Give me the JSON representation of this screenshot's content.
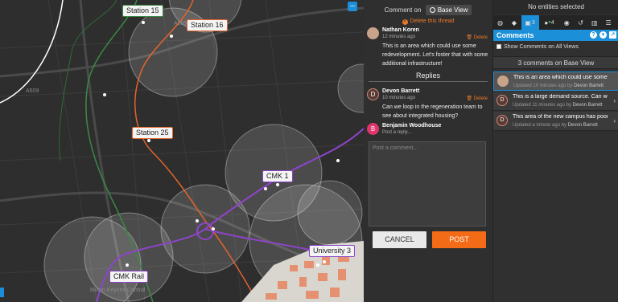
{
  "map": {
    "labels": {
      "station15": "Station 15",
      "station16": "Station 16",
      "station25": "Station 25",
      "cmk1": "CMK 1",
      "cmkrail": "CMK Rail",
      "university3": "University 3"
    },
    "roads": {
      "a509a": "A509",
      "a509b": "A509",
      "mkcentral": "Milton Keynes Central"
    }
  },
  "thread": {
    "comment_on": "Comment on",
    "view": "Base View",
    "delete_thread": "Delete this thread",
    "main": {
      "author": "Nathan Koren",
      "time": "12 minutes ago",
      "delete": "Delete",
      "text": "This is an area which could use some redevelopment. Let's foster that with some additional infrastructure!"
    },
    "replies_title": "Replies",
    "reply": {
      "author": "Devon Barrett",
      "time": "10 minutes ago",
      "delete": "Delete",
      "text": "Can we loop in the regeneration team to see about integrated housing?",
      "initial": "D"
    },
    "draft": {
      "author": "Benjamin Woodhouse",
      "placeholder": "Post a reply...",
      "initial": "B",
      "textarea_placeholder": "Post a comment..."
    },
    "cancel": "CANCEL",
    "post": "POST"
  },
  "side": {
    "selection": "No entities selected",
    "tabs": [
      "3",
      "4"
    ],
    "comments_title": "Comments",
    "show_all": "Show Comments on All Views",
    "count_label": "3 comments on Base View",
    "rows": [
      {
        "text": "This is an area which could use some r...",
        "meta": "Updated 10 minutes ago by",
        "by": "Devon Barrett"
      },
      {
        "text": "This is a large demand source. Can we ...",
        "meta": "Updated 11 minutes ago by",
        "by": "Devon Barrett",
        "initial": "D"
      },
      {
        "text": "This area of the new campus has poor ...",
        "meta": "Updated a minute ago by",
        "by": "Devon Barrett",
        "initial": "D"
      }
    ]
  },
  "colors": {
    "accent": "#1b8fd8",
    "orange": "#f36b17",
    "green": "#3a8a45",
    "purple": "#8e44c9"
  }
}
